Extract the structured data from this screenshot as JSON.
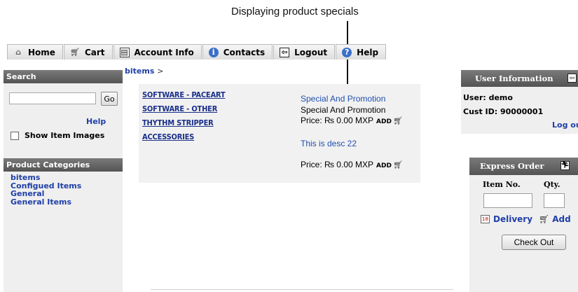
{
  "callout": {
    "text": "Displaying product specials"
  },
  "nav": {
    "tabs": [
      {
        "label": "Home",
        "icon": "home-icon"
      },
      {
        "label": "Cart",
        "icon": "cart-icon"
      },
      {
        "label": "Account Info",
        "icon": "account-icon"
      },
      {
        "label": "Contacts",
        "icon": "info-icon"
      },
      {
        "label": "Logout",
        "icon": "logout-icon"
      },
      {
        "label": "Help",
        "icon": "help-icon"
      }
    ]
  },
  "sidebar": {
    "search_title": "Search",
    "search_placeholder": "",
    "go_label": "Go",
    "help_label": "Help",
    "show_images_label": "Show Item Images",
    "categories_title": "Product Categories",
    "categories": [
      "bitems",
      "Configued Items",
      "General",
      "General Items"
    ]
  },
  "breadcrumb": {
    "link": "bitems",
    "sep": ">"
  },
  "specials": {
    "products": [
      "SOFTWARE - PACEART",
      "SOFTWARE - OTHER",
      "THYTHM STRIPPER",
      "ACCESSORIES"
    ],
    "promo_title": "Special And Promotion",
    "promo_subtitle": "Special And Promotion",
    "price1": "Price: ₨  0.00 MXP",
    "desc": "This is desc 22",
    "price2": "Price: ₨  0.00 MXP",
    "add_label": "ADD"
  },
  "user_info": {
    "title": "User Information",
    "user": "User: demo",
    "cust_id": "Cust ID: 90000001",
    "logout": "Log ou"
  },
  "express_order": {
    "title": "Express Order",
    "item_no_label": "Item No.",
    "qty_label": "Qty.",
    "delivery_label": "Delivery",
    "add_label": "Add",
    "checkout_label": "Check Out"
  },
  "colors": {
    "link": "#1f3fa8",
    "header_bar": "#5f5f5f",
    "panel_bg": "#efefef"
  }
}
